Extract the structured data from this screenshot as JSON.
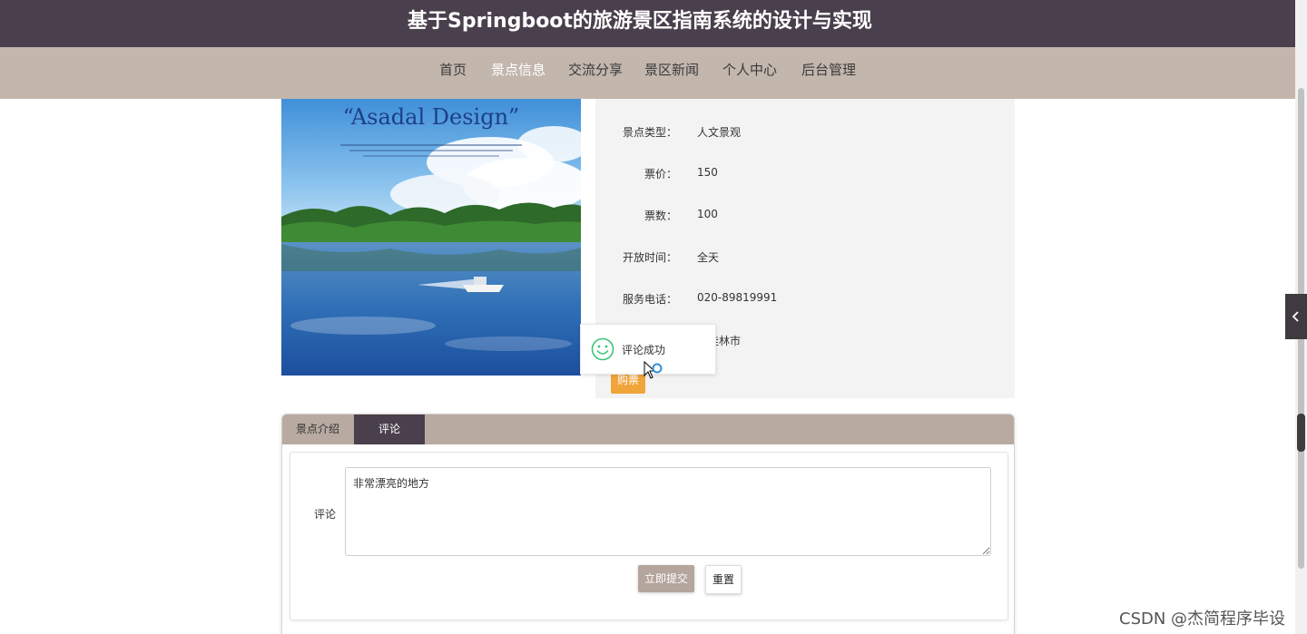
{
  "site": {
    "title": "基于Springboot的旅游景区指南系统的设计与实现"
  },
  "nav": {
    "items": [
      {
        "label": "首页",
        "active": false
      },
      {
        "label": "景点信息",
        "active": true
      },
      {
        "label": "交流分享",
        "active": false
      },
      {
        "label": "景区新闻",
        "active": false
      },
      {
        "label": "个人中心",
        "active": false
      },
      {
        "label": "后台管理",
        "active": false
      }
    ]
  },
  "detail": {
    "image_caption": "“Asadal Design”",
    "fields": [
      {
        "label": "景点类型：",
        "value": "人文景观"
      },
      {
        "label": "票价：",
        "value": "150"
      },
      {
        "label": "票数：",
        "value": "100"
      },
      {
        "label": "开放时间：",
        "value": "全天"
      },
      {
        "label": "服务电话：",
        "value": "020-89819991"
      },
      {
        "label": "",
        "value": "桂林市"
      }
    ],
    "buy_label": "购票"
  },
  "toast": {
    "message": "评论成功",
    "icon": "smiley-icon"
  },
  "tabs": {
    "items": [
      {
        "label": "景点介绍",
        "active": false
      },
      {
        "label": "评论",
        "active": true
      }
    ]
  },
  "comment_form": {
    "label": "评论",
    "value": "非常漂亮的地方",
    "submit_label": "立即提交",
    "reset_label": "重置"
  },
  "watermark": "CSDN @杰简程序毕设",
  "colors": {
    "header_bg": "#4a3f4c",
    "nav_bg": "#c3b6ad",
    "buy_button": "#f0a43a",
    "submit_button": "#b4a59d"
  }
}
